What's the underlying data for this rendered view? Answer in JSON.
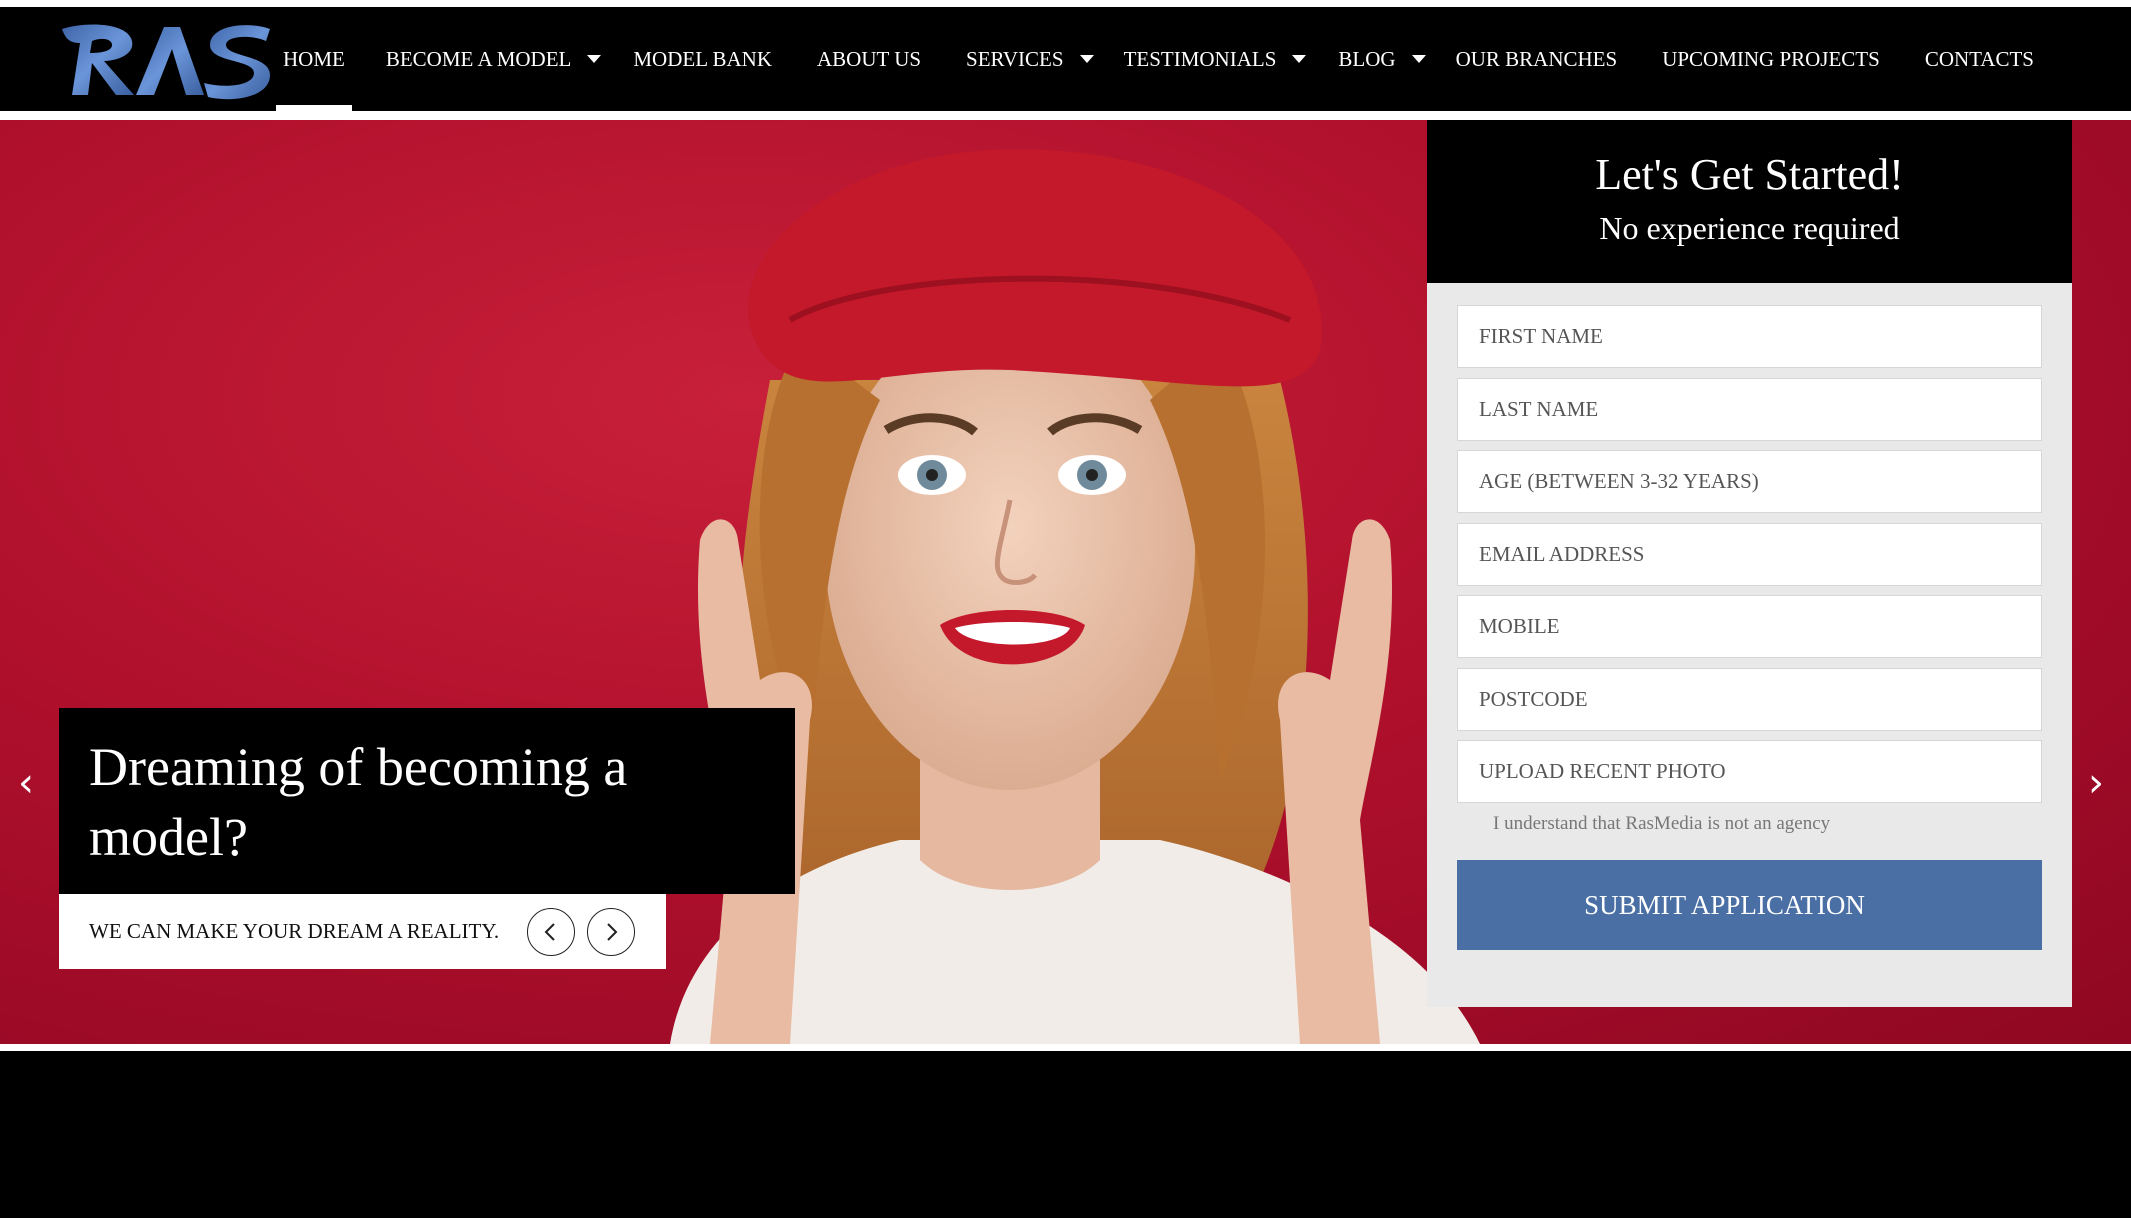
{
  "nav": {
    "items": [
      {
        "label": "HOME"
      },
      {
        "label": "BECOME A MODEL"
      },
      {
        "label": "MODEL BANK"
      },
      {
        "label": "ABOUT US"
      },
      {
        "label": "SERVICES"
      },
      {
        "label": "TESTIMONIALS"
      },
      {
        "label": "BLOG"
      },
      {
        "label": "OUR BRANCHES"
      },
      {
        "label": "UPCOMING PROJECTS"
      },
      {
        "label": "CONTACTS"
      }
    ]
  },
  "logo": {
    "icon": "ras-logo",
    "color": "#4a78c0"
  },
  "hero": {
    "headline": "Dreaming of becoming a model?",
    "subtext": "WE CAN MAKE YOUR DREAM A REALITY.",
    "prev_arrow": "‹",
    "next_arrow": "›",
    "background_color": "#b0102c"
  },
  "form": {
    "title": "Let's Get Started!",
    "subtitle": "No experience required",
    "fields": {
      "first_name": "FIRST NAME",
      "last_name": "LAST NAME",
      "age": "AGE (BETWEEN 3-32 YEARS)",
      "email": "EMAIL ADDRESS",
      "mobile": "MOBILE",
      "postcode": "POSTCODE",
      "photo": "UPLOAD RECENT PHOTO"
    },
    "agree_text": "I understand that RasMedia is not an agency",
    "submit_label": "SUBMIT APPLICATION",
    "submit_color": "#4a6fa5"
  }
}
